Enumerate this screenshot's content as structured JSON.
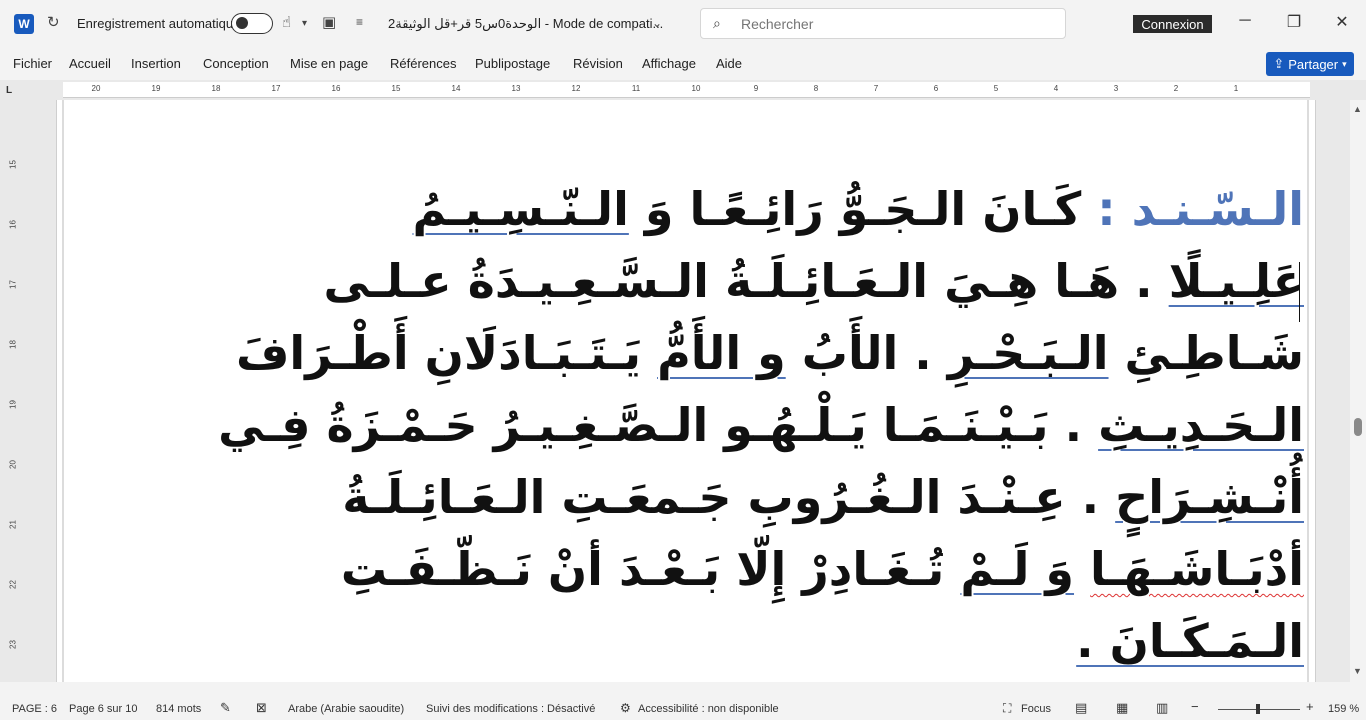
{
  "titlebar": {
    "app_logo": "W",
    "autosave_label": "Enregistrement automatique",
    "document_title": "الوحدة0س5 قر+قل الوثيقة2  -  Mode de compati...",
    "search_placeholder": "Rechercher",
    "login_label": "Connexion"
  },
  "menu": {
    "items": [
      "Fichier",
      "Accueil",
      "Insertion",
      "Conception",
      "Mise en page",
      "Références",
      "Publipostage",
      "Révision",
      "Affichage",
      "Aide"
    ],
    "share_label": "Partager"
  },
  "ruler": {
    "numbers": [
      "20",
      "19",
      "18",
      "17",
      "16",
      "15",
      "14",
      "13",
      "12",
      "11",
      "10",
      "9",
      "8",
      "7",
      "6",
      "5",
      "4",
      "3",
      "2",
      "1"
    ]
  },
  "vruler": {
    "numbers": [
      "15",
      "16",
      "17",
      "18",
      "19",
      "20",
      "21",
      "22",
      "23"
    ]
  },
  "document": {
    "line1_heading": "الـسّـنـد :",
    "line1_text": " كَـانَ   الـجَـوُّ   رَائِـعًـا   وَ   ",
    "line1_ul": "الـنّـسِـيـمُ",
    "line2_ul": "عَلِـيـلًا",
    "line2_text": " .  هَـا  هِـيَ  الـعَـائِـلَـةُ  الـسَّـعِـيـدَةُ  عـلـى",
    "line3_text": "شَـاطِـئِ  ",
    "line3_ul": "الـبَـحْـرِ",
    "line3_text2": " .  الأَبُ  ",
    "line3_ul2": "و  الأَمُّ",
    "line3_text3": "  يَـتَـبَـادَلَانِ  أَطْـرَافَ",
    "line4_ul": "الـحَـدِيـثِ",
    "line4_text": " .  بَـيْـنَـمَـا  يَـلْـهُـو  الـصَّـغِـيـرُ  حَـمْـزَةُ  فِـي",
    "line5_ul": "أُنْـشِـرَاحٍ",
    "line5_text": " .  عِـنْـدَ  الـغُـرُوبِ  جَـمعَـتِ  الـعَـائِـلَـةُ",
    "line6_ul_red": "أدْبَـاشَـهَـا",
    "line6_text": "  ",
    "line6_ul": "وَ  لَـمْ",
    "line6_text2": "  تُـغَـادِرْ  إِلّا  بَـعْـدَ  أنْ  نَـظّـفَـتِ",
    "line7_ul": "الـمَـكَـانَ  ."
  },
  "statusbar": {
    "page_label": "PAGE : 6",
    "page_of": "Page 6 sur 10",
    "word_count": "814 mots",
    "language": "Arabe (Arabie saoudite)",
    "track_changes": "Suivi des modifications : Désactivé",
    "accessibility": "Accessibilité : non disponible",
    "focus_label": "Focus",
    "zoom_label": "159 %"
  }
}
